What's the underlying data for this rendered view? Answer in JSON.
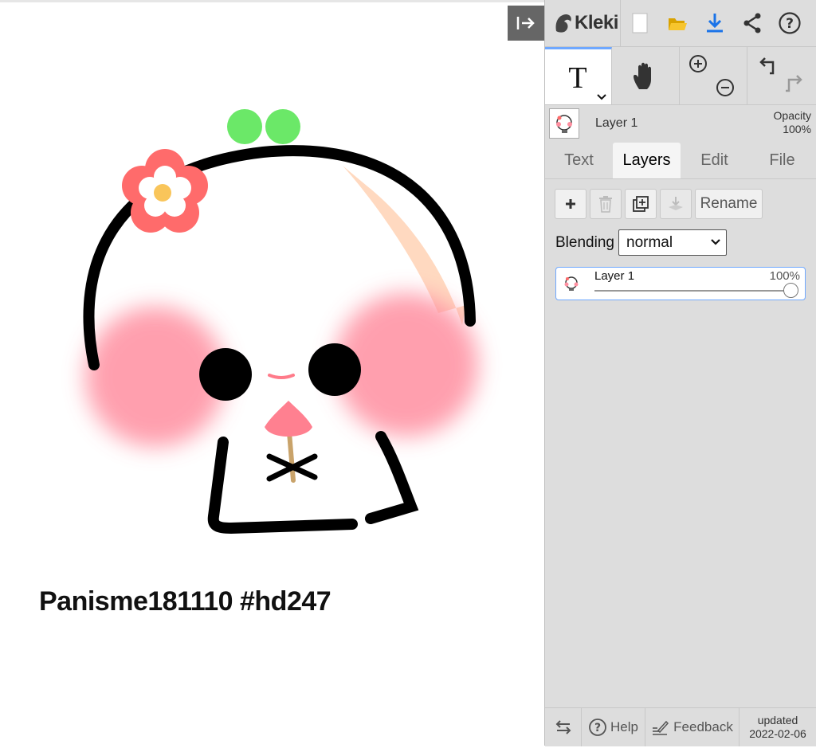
{
  "canvas": {
    "caption": "Panisme181110 #hd247",
    "collapse_icon": "arrow-right-to-bar-icon"
  },
  "sidebar": {
    "brand": "Kleki",
    "top_icons": [
      "new-file-icon",
      "open-folder-icon",
      "download-icon",
      "share-icon",
      "help-circle-icon"
    ],
    "tools": {
      "active": "text-tool",
      "items": [
        "text-tool",
        "hand-tool",
        "zoom-in-out",
        "undo-redo"
      ]
    },
    "layer_header": {
      "name": "Layer 1",
      "opacity_label": "Opacity",
      "opacity_value": "100%"
    },
    "tabs": [
      {
        "label": "Text"
      },
      {
        "label": "Layers"
      },
      {
        "label": "Edit"
      },
      {
        "label": "File"
      }
    ],
    "active_tab": "Layers",
    "layers_panel": {
      "rename_label": "Rename",
      "blending_label": "Blending",
      "blending_value": "normal",
      "layers": [
        {
          "name": "Layer 1",
          "opacity": "100%",
          "opacity_fraction": 1.0
        }
      ]
    },
    "footer": {
      "help_label": "Help",
      "feedback_label": "Feedback",
      "updated_label": "updated",
      "updated_date": "2022-02-06"
    },
    "colors": {
      "sidebar_bg": "#dddddd",
      "accent": "#6fa8ff",
      "download_blue": "#1a73e8",
      "folder_yellow": "#f2b705"
    }
  }
}
